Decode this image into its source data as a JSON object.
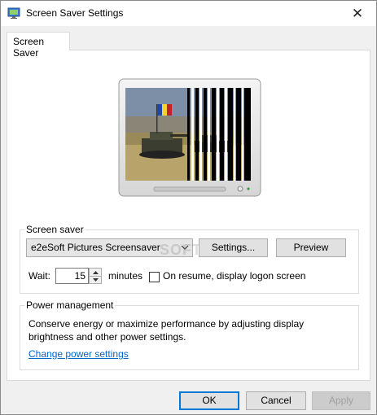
{
  "window": {
    "title": "Screen Saver Settings",
    "close_symbol": "✕"
  },
  "tabs": [
    {
      "label": "Screen Saver",
      "active": true
    }
  ],
  "screen_saver": {
    "group_label": "Screen saver",
    "selected": "e2eSoft Pictures Screensaver",
    "settings_label": "Settings...",
    "preview_label": "Preview",
    "wait_label": "Wait:",
    "wait_value": "15",
    "minutes_label": "minutes",
    "logon_checkbox_label": "On resume, display logon screen",
    "logon_checked": false
  },
  "power": {
    "group_label": "Power management",
    "description": "Conserve energy or maximize performance by adjusting display brightness and other power settings.",
    "link_label": "Change power settings"
  },
  "footer": {
    "ok_label": "OK",
    "cancel_label": "Cancel",
    "apply_label": "Apply",
    "apply_enabled": false
  },
  "watermark": "SOFTPEDIA",
  "icons": {
    "app": "screen-saver-app-icon",
    "close": "close-icon",
    "dropdown": "chevron-down-icon",
    "spin_up": "spin-up-icon",
    "spin_down": "spin-down-icon"
  }
}
